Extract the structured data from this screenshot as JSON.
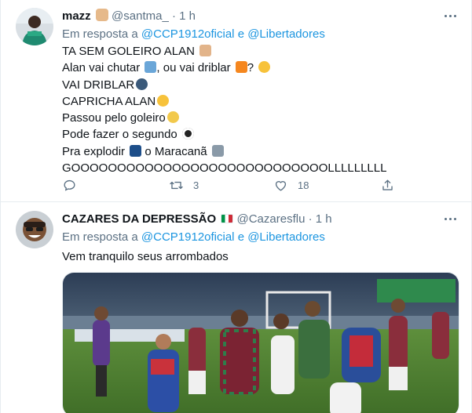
{
  "tweets": [
    {
      "display_name": "mazz",
      "name_emoji": "raised-fist-emoji",
      "handle": "@santma_",
      "separator": "·",
      "time": "1 h",
      "reply_prefix": "Em resposta a",
      "reply_mention_1": "@CCP1912oficial",
      "reply_conj": "e",
      "reply_mention_2": "@Libertadores",
      "lines": [
        {
          "text": "TA SEM GOLEIRO ALAN",
          "emoji": "raised-hands-emoji",
          "suffix": ""
        },
        {
          "text": "Alan vai chutar",
          "emoji": "kicking-person-emoji",
          "suffix": ", ou vai driblar"
        },
        {
          "text": "VAI DRIBLAR",
          "emoji": "speaking-head-emoji",
          "suffix": ""
        },
        {
          "text": "CAPRICHA ALAN",
          "emoji": "star-struck-emoji",
          "suffix": ""
        },
        {
          "text": "Passou pelo goleiro",
          "emoji": "screaming-face-emoji",
          "suffix": ""
        },
        {
          "text": "Pode fazer o segundo",
          "emoji": "soccer-ball-emoji",
          "suffix": ""
        },
        {
          "text": "Pra explodir",
          "emoji": "sparkler-emoji",
          "suffix": "o Maracanã"
        },
        {
          "text": "GOOOOOOOOOOOOOOOOOOOOOOOOOOOOLLLLLLLLL",
          "emoji": "",
          "suffix": ""
        }
      ],
      "line2_tail": "?",
      "replies_count": "",
      "retweets_count": "3",
      "likes_count": "18"
    },
    {
      "display_name": "CAZARES DA DEPRESSÃO",
      "name_emoji": "italy-flag-emoji",
      "handle": "@Cazaresflu",
      "separator": "·",
      "time": "1 h",
      "reply_prefix": "Em resposta a",
      "reply_mention_1": "@CCP1912oficial",
      "reply_conj": "e",
      "reply_mention_2": "@Libertadores",
      "text": "Vem tranquilo seus arrombados",
      "media_description_label": "football-players-brawl-photo"
    }
  ],
  "colors": {
    "text_primary": "#0f1419",
    "text_secondary": "#5b7083",
    "link": "#1b95e0",
    "divider": "#e6ecf0"
  }
}
